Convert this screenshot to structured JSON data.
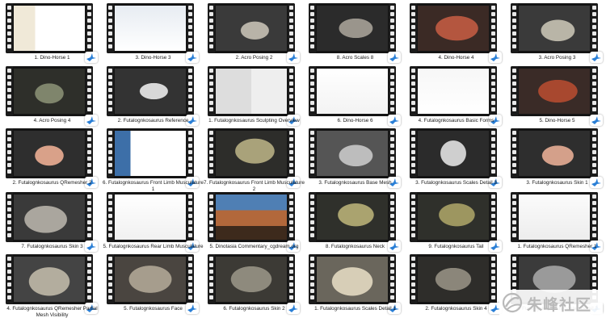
{
  "thumbnails": [
    {
      "caption": "1. Dino-Horse 1"
    },
    {
      "caption": "3. Dino-Horse 3"
    },
    {
      "caption": "2. Acro Posing 2"
    },
    {
      "caption": "8. Acro Scales 8"
    },
    {
      "caption": "4. Dino-Horse 4"
    },
    {
      "caption": "3. Acro Posing 3"
    },
    {
      "caption": "4. Acro Posing 4"
    },
    {
      "caption": "2. Futalognkosaurus Reference"
    },
    {
      "caption": "1. Futalognkosaurus Sculpting Overview"
    },
    {
      "caption": "6. Dino-Horse 6"
    },
    {
      "caption": "4. Futalognkosaurus Basic Forms"
    },
    {
      "caption": "5. Dino-Horse 5"
    },
    {
      "caption": "2. Futalognkosaurus QRemesher 2"
    },
    {
      "caption": "6. Futalognkosaurus Front Limb Musculature 1"
    },
    {
      "caption": "7. Futalognkosaurus Front Limb Musculature 2"
    },
    {
      "caption": "3. Futalognkosaurus Base Mesh"
    },
    {
      "caption": "3. Futalognkosaurus Scales Detail 3"
    },
    {
      "caption": "3. Futalognkosaurus Skin 1"
    },
    {
      "caption": "7. Futalognkosaurus Skin 3"
    },
    {
      "caption": "5. Futalognkosaurus Rear Limb Musculature"
    },
    {
      "caption": "5. Dinotasia Commentary_cgdream.org"
    },
    {
      "caption": "8. Futalognkosaurus Neck"
    },
    {
      "caption": "9. Futalognkosaurus Tail"
    },
    {
      "caption": "1. Futalognkosaurus QRemesher 1"
    },
    {
      "caption": "4. Futalognkosaurus QRemesher Partial Mesh Visibility"
    },
    {
      "caption": "5. Futalognkosaurus Face"
    },
    {
      "caption": "6. Futalognkosaurus Skin 2"
    },
    {
      "caption": "1. Futalognkosaurus Scales Detail 1"
    },
    {
      "caption": "2. Futalognkosaurus Skin 4"
    },
    {
      "caption": "4. Futalognkosaurus Scales Detail 2"
    }
  ],
  "watermark": {
    "text": "朱峰社区"
  },
  "icons": {
    "badge": "bird-player-icon",
    "logo": "flower-logo-icon"
  },
  "colors": {
    "badge_blue": "#2a7fd6",
    "film": "#141414"
  }
}
